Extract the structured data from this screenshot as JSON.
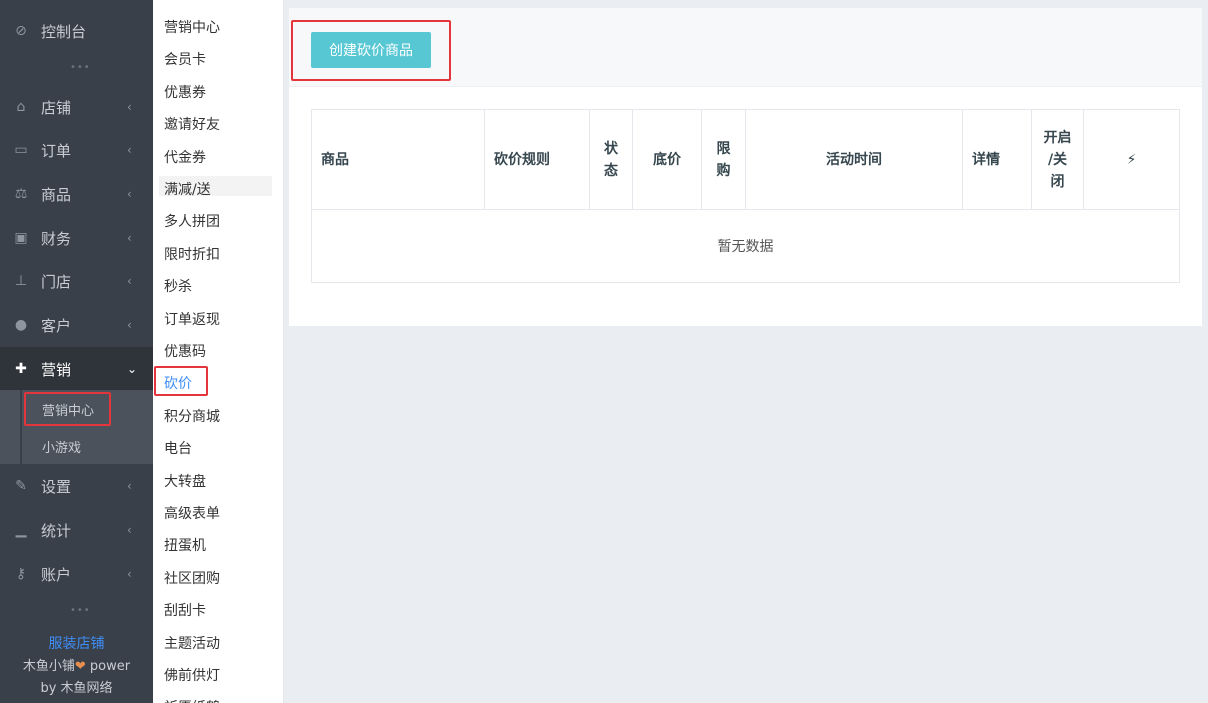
{
  "sidebar": {
    "items": [
      {
        "label": "控制台",
        "icon": "dashboard-icon",
        "glyph": "⊘"
      },
      {
        "label": "店铺",
        "icon": "shop-icon",
        "glyph": "⌂"
      },
      {
        "label": "订单",
        "icon": "order-icon",
        "glyph": "▭"
      },
      {
        "label": "商品",
        "icon": "scale-icon",
        "glyph": "⚖"
      },
      {
        "label": "财务",
        "icon": "money-icon",
        "glyph": "▣"
      },
      {
        "label": "门店",
        "icon": "sitemap-icon",
        "glyph": "⊥"
      },
      {
        "label": "客户",
        "icon": "users-icon",
        "glyph": "●"
      },
      {
        "label": "营销",
        "icon": "gift-icon",
        "glyph": "✚"
      },
      {
        "label": "设置",
        "icon": "wrench-icon",
        "glyph": "✎"
      },
      {
        "label": "统计",
        "icon": "signal-icon",
        "glyph": "▁"
      },
      {
        "label": "账户",
        "icon": "key-icon",
        "glyph": "⚷"
      }
    ],
    "chevron_left": "‹",
    "chevron_down": "⌄",
    "dots": "•••",
    "sub_items": [
      {
        "label": "营销中心"
      },
      {
        "label": "小游戏"
      }
    ],
    "shop_name": "服装店铺",
    "power_prefix": "木鱼小铺",
    "heart": "❤",
    "power_suffix": " power",
    "by_text": "by 木鱼网络"
  },
  "menu2": {
    "items": [
      "营销中心",
      "会员卡",
      "优惠券",
      "邀请好友",
      "代金券",
      "满减/送",
      "多人拼团",
      "限时折扣",
      "秒杀",
      "订单返现",
      "优惠码",
      "砍价",
      "积分商城",
      "电台",
      "大转盘",
      "高级表单",
      "扭蛋机",
      "社区团购",
      "刮刮卡",
      "主题活动",
      "佛前供灯",
      "祈愿纸鹤"
    ],
    "active_index": 11
  },
  "main": {
    "create_button": "创建砍价商品",
    "columns": [
      {
        "label": "商品",
        "lines": [
          "商品"
        ]
      },
      {
        "label": "砍价规则",
        "lines": [
          "砍价规则"
        ]
      },
      {
        "label": "状态",
        "lines": [
          "状",
          "态"
        ]
      },
      {
        "label": "底价",
        "lines": [
          "底价"
        ]
      },
      {
        "label": "限购",
        "lines": [
          "限",
          "购"
        ]
      },
      {
        "label": "活动时间",
        "lines": [
          "活动时间"
        ]
      },
      {
        "label": "详情",
        "lines": [
          "详情"
        ]
      },
      {
        "label": "开启/关闭",
        "lines": [
          "开启",
          "/关",
          "闭"
        ]
      },
      {
        "label": "操作",
        "lines": [
          "⚡"
        ]
      }
    ],
    "empty_text": "暂无数据"
  },
  "colors": {
    "sidebar_bg": "#3a4049",
    "button_bg": "#57c7d4",
    "active_link": "#3e8ef7",
    "highlight_border": "#e5353c"
  }
}
